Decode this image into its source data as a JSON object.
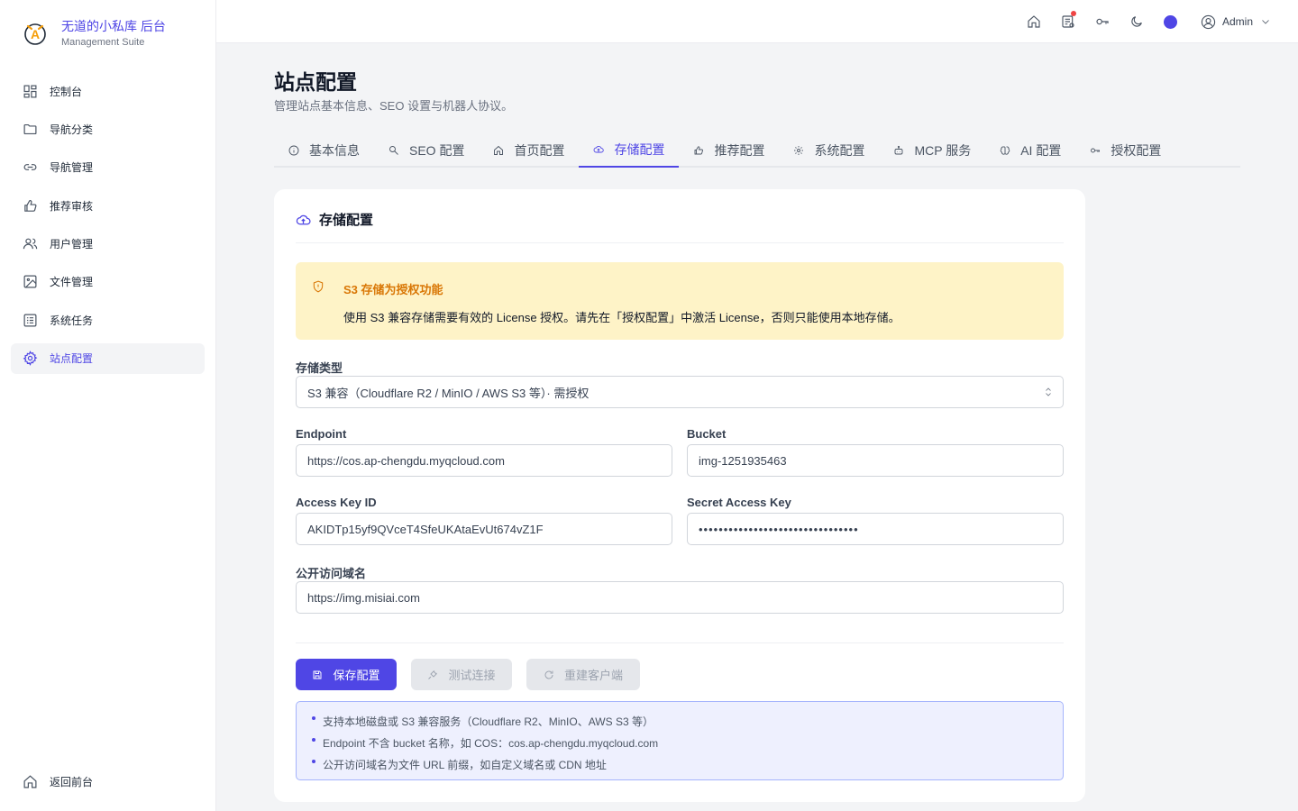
{
  "brand": {
    "title": "无道的小私库 后台",
    "subtitle": "Management Suite",
    "logo_letter": "A"
  },
  "sidebar": {
    "items": [
      {
        "label": "控制台",
        "icon": "dashboard-icon"
      },
      {
        "label": "导航分类",
        "icon": "folder-icon"
      },
      {
        "label": "导航管理",
        "icon": "link-icon"
      },
      {
        "label": "推荐审核",
        "icon": "thumbs-up-icon"
      },
      {
        "label": "用户管理",
        "icon": "users-icon"
      },
      {
        "label": "文件管理",
        "icon": "image-icon"
      },
      {
        "label": "系统任务",
        "icon": "list-icon"
      },
      {
        "label": "站点配置",
        "icon": "gear-icon",
        "active": true
      }
    ],
    "bottom": {
      "label": "返回前台",
      "icon": "home-icon"
    }
  },
  "topbar": {
    "user": "Admin"
  },
  "page": {
    "title": "站点配置",
    "description": "管理站点基本信息、SEO 设置与机器人协议。"
  },
  "tabs": [
    {
      "label": "基本信息"
    },
    {
      "label": "SEO 配置"
    },
    {
      "label": "首页配置"
    },
    {
      "label": "存储配置",
      "active": true
    },
    {
      "label": "推荐配置"
    },
    {
      "label": "系统配置"
    },
    {
      "label": "MCP 服务"
    },
    {
      "label": "AI 配置"
    },
    {
      "label": "授权配置"
    }
  ],
  "storage": {
    "title": "存储配置",
    "notice": {
      "title": "S3 存储为授权功能",
      "text": "使用 S3 兼容存储需要有效的 License 授权。请先在「授权配置」中激活 License，否则只能使用本地存储。"
    },
    "type": {
      "label": "存储类型",
      "value": "S3 兼容（Cloudflare R2 / MinIO / AWS S3 等）· 需授权"
    },
    "endpoint": {
      "label": "Endpoint",
      "value": "https://cos.ap-chengdu.myqcloud.com"
    },
    "bucket": {
      "label": "Bucket",
      "value": "img-1251935463"
    },
    "access_key": {
      "label": "Access Key ID",
      "value": "AKIDTp15yf9QVceT4SfeUKAtaEvUt674vZ1F"
    },
    "secret_key": {
      "label": "Secret Access Key",
      "value": "••••••••••••••••••••••••••••••••"
    },
    "public_domain": {
      "label": "公开访问域名",
      "value": "https://img.misiai.com"
    },
    "buttons": {
      "save": "保存配置",
      "test": "测试连接",
      "rebuild": "重建客户端"
    },
    "tips": [
      "支持本地磁盘或 S3 兼容服务（Cloudflare R2、MinIO、AWS S3 等）",
      "Endpoint 不含 bucket 名称，如 COS：cos.ap-chengdu.myqcloud.com",
      "公开访问域名为文件 URL 前缀，如自定义域名或 CDN 地址"
    ]
  },
  "colors": {
    "accent": "#4f46e5",
    "warning_bg": "#fef3c7",
    "warning_text": "#d97706",
    "notification": "#ef4444"
  }
}
